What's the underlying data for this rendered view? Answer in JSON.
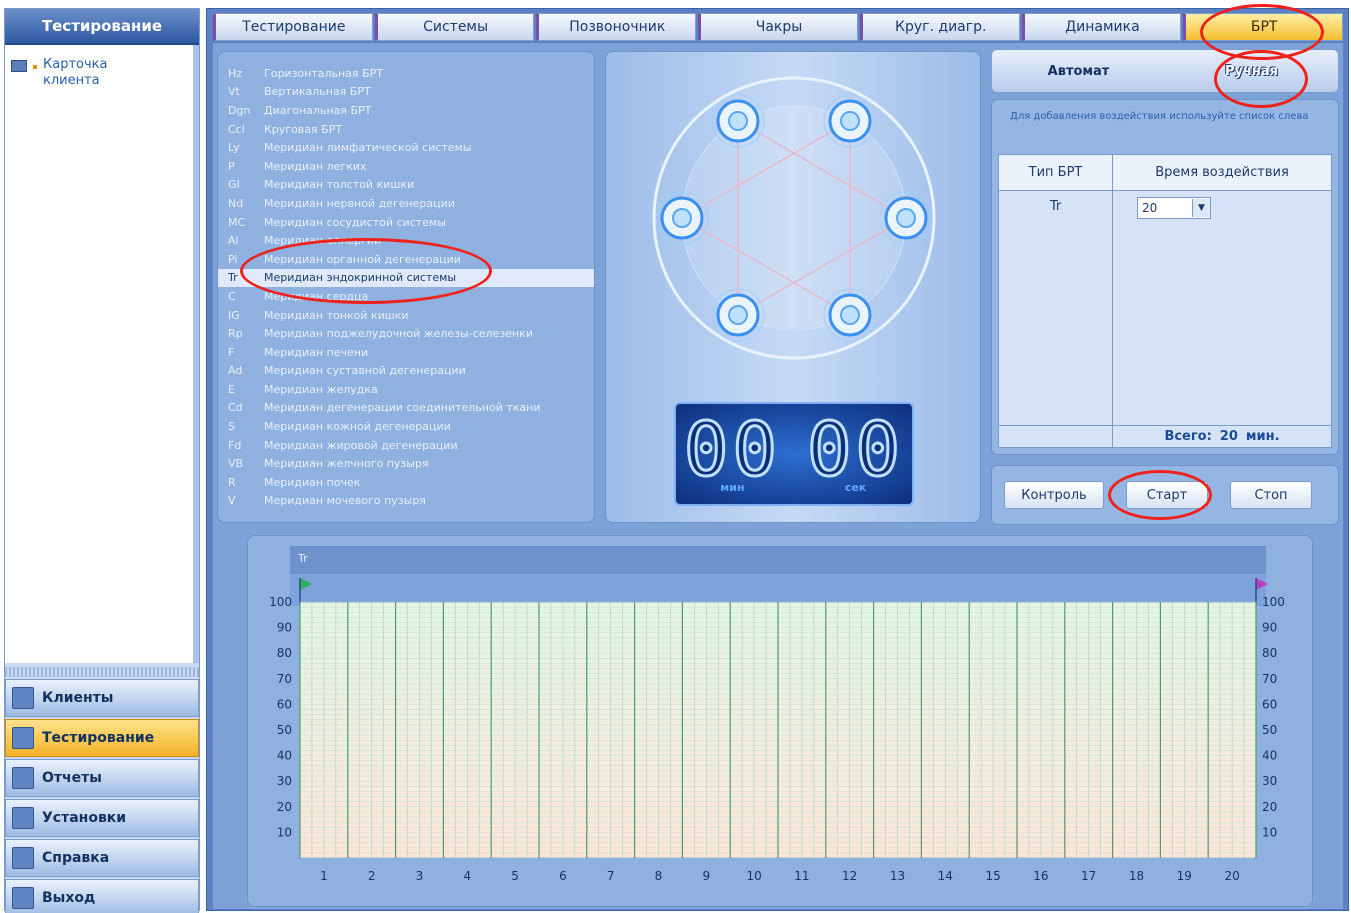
{
  "sidebar": {
    "title": "Тестирование",
    "tree_item": "Карточка клиента",
    "nav": [
      {
        "label": "Клиенты",
        "icon": "clients-icon",
        "active": false
      },
      {
        "label": "Тестирование",
        "icon": "testing-icon",
        "active": true
      },
      {
        "label": "Отчеты",
        "icon": "reports-icon",
        "active": false
      },
      {
        "label": "Установки",
        "icon": "settings-icon",
        "active": false
      },
      {
        "label": "Справка",
        "icon": "help-icon",
        "active": false
      },
      {
        "label": "Выход",
        "icon": "exit-icon",
        "active": false
      }
    ]
  },
  "tabs": [
    {
      "label": "Тестирование",
      "active": false
    },
    {
      "label": "Системы",
      "active": false
    },
    {
      "label": "Позвоночник",
      "active": false
    },
    {
      "label": "Чакры",
      "active": false
    },
    {
      "label": "Круг. диагр.",
      "active": false
    },
    {
      "label": "Динамика",
      "active": false
    },
    {
      "label": "БРТ",
      "active": true
    }
  ],
  "meridians": [
    {
      "code": "Hz",
      "name": "Горизонтальная БРТ"
    },
    {
      "code": "Vt",
      "name": "Вертикальная БРТ"
    },
    {
      "code": "Dgn",
      "name": "Диагональная БРТ"
    },
    {
      "code": "Ccl",
      "name": "Круговая БРТ"
    },
    {
      "code": "Ly",
      "name": "Меридиан лимфатической системы"
    },
    {
      "code": "P",
      "name": "Меридиан легких"
    },
    {
      "code": "GI",
      "name": "Меридиан толстой кишки"
    },
    {
      "code": "Nd",
      "name": "Меридиан нервной дегенерации"
    },
    {
      "code": "MC",
      "name": "Меридиан сосудистой системы"
    },
    {
      "code": "Al",
      "name": "Меридиан аллергии"
    },
    {
      "code": "Pi",
      "name": "Меридиан органной дегенерации"
    },
    {
      "code": "Tr",
      "name": "Меридиан эндокринной системы"
    },
    {
      "code": "C",
      "name": "Меридиан сердца"
    },
    {
      "code": "IG",
      "name": "Меридиан тонкой кишки"
    },
    {
      "code": "Rp",
      "name": "Меридиан поджелудочной железы-селезенки"
    },
    {
      "code": "F",
      "name": "Меридиан печени"
    },
    {
      "code": "Ad",
      "name": "Меридиан суставной дегенерации"
    },
    {
      "code": "E",
      "name": "Меридиан желудка"
    },
    {
      "code": "Cd",
      "name": "Меридиан дегенерации соединительной ткани"
    },
    {
      "code": "S",
      "name": "Меридиан кожной дегенерации"
    },
    {
      "code": "Fd",
      "name": "Меридиан жировой дегенерации"
    },
    {
      "code": "VB",
      "name": "Меридиан желчного пузыря"
    },
    {
      "code": "R",
      "name": "Меридиан почек"
    },
    {
      "code": "V",
      "name": "Меридиан мочевого пузыря"
    }
  ],
  "selected_meridian": "Tr",
  "timer": {
    "minutes": "00",
    "seconds": "00",
    "min_unit": "мин",
    "sec_unit": "сек"
  },
  "mode": {
    "auto": "Автомат",
    "manual": "Ручная",
    "active": "manual"
  },
  "hint": "Для добавления воздействия используйте список слева",
  "brt_table": {
    "col_type": "Тип БРТ",
    "col_time": "Время воздействия",
    "rows": [
      {
        "type": "Tr",
        "time": "20"
      }
    ],
    "total_label": "Всего:",
    "total_value": "20",
    "total_unit": "мин."
  },
  "buttons": {
    "control": "Контроль",
    "start": "Старт",
    "stop": "Стоп"
  },
  "chart_data": {
    "type": "line",
    "title": "Tr",
    "x": [
      1,
      2,
      3,
      4,
      5,
      6,
      7,
      8,
      9,
      10,
      11,
      12,
      13,
      14,
      15,
      16,
      17,
      18,
      19,
      20
    ],
    "yticks": [
      10,
      20,
      30,
      40,
      50,
      60,
      70,
      80,
      90,
      100
    ],
    "xlim": [
      1,
      20
    ],
    "ylim": [
      0,
      100
    ],
    "series": [],
    "grid": true,
    "start_flag_color": "#2bb24c",
    "end_flag_color": "#c03cc0"
  },
  "colors": {
    "accent": "#f4bd2f",
    "panel": "#8fb1e0",
    "annotation": "#f0201a"
  }
}
